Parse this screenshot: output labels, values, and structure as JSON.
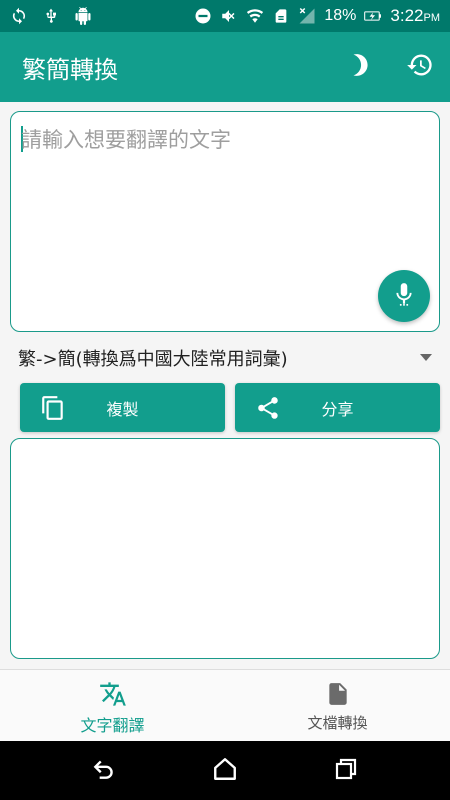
{
  "status_bar": {
    "battery_percent": "18%",
    "time": "3:22",
    "ampm": "PM"
  },
  "app_bar": {
    "title": "繁簡轉換",
    "actions": [
      "theme-moon-icon",
      "history-icon"
    ]
  },
  "input": {
    "placeholder": "請輸入想要翻譯的文字",
    "value": ""
  },
  "mode": {
    "selected": "繁->簡(轉換爲中國大陸常用詞彙)"
  },
  "buttons": {
    "copy_label": "複製",
    "share_label": "分享"
  },
  "output": {
    "value": ""
  },
  "bottom_nav": {
    "items": [
      {
        "label": "文字翻譯",
        "icon": "translate-icon",
        "active": true
      },
      {
        "label": "文檔轉換",
        "icon": "document-icon",
        "active": false
      }
    ]
  },
  "colors": {
    "primary": "#129e8d",
    "status_bar": "#00796b",
    "accent_border": "#1a9a8a"
  }
}
